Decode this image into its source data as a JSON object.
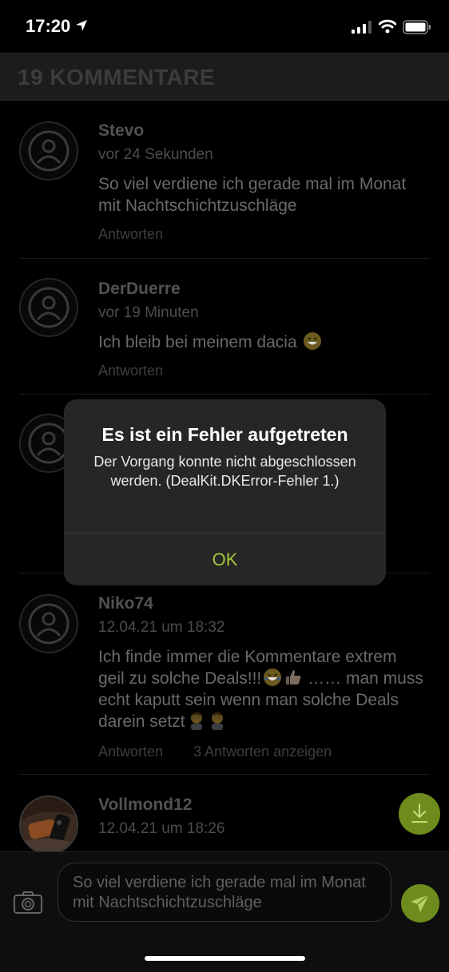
{
  "status_bar": {
    "time": "17:20"
  },
  "header": {
    "title": "19 KOMMENTARE"
  },
  "comments": [
    {
      "name": "Stevo",
      "time": "vor 24 Sekunden",
      "text": "So viel verdiene ich gerade mal im Monat mit Nachtschichtzuschläge",
      "reply_label": "Antworten"
    },
    {
      "name": "DerDuerre",
      "time": "vor 19 Minuten",
      "text": "Ich bleib bei meinem dacia",
      "reply_label": "Antworten"
    },
    {
      "name": "Niko74",
      "time": "12.04.21 um 18:32",
      "text": "Ich finde immer die Kommentare extrem geil zu solche Deals!!!",
      "text2": "…… man muss echt kaputt sein wenn man solche Deals darein setzt",
      "reply_label": "Antworten",
      "more_label": "3 Antworten anzeigen"
    },
    {
      "name": "Vollmond12",
      "time": "12.04.21 um 18:26"
    }
  ],
  "dialog": {
    "title": "Es ist ein Fehler aufgetreten",
    "message": "Der Vorgang konnte nicht abgeschlossen werden. (DealKit.DKError-Fehler 1.)",
    "ok_label": "OK"
  },
  "composer": {
    "text": "So viel verdiene ich gerade mal im Monat mit Nachtschichtzuschläge"
  },
  "colors": {
    "accent": "#a4c73a",
    "fab": "#6e8c1d",
    "background": "#000000",
    "dialog": "#262626"
  },
  "icons": [
    "location-arrow-icon",
    "signal-icon",
    "wifi-icon",
    "battery-icon",
    "camera-icon",
    "send-icon",
    "download-icon",
    "avatar-placeholder-icon"
  ]
}
